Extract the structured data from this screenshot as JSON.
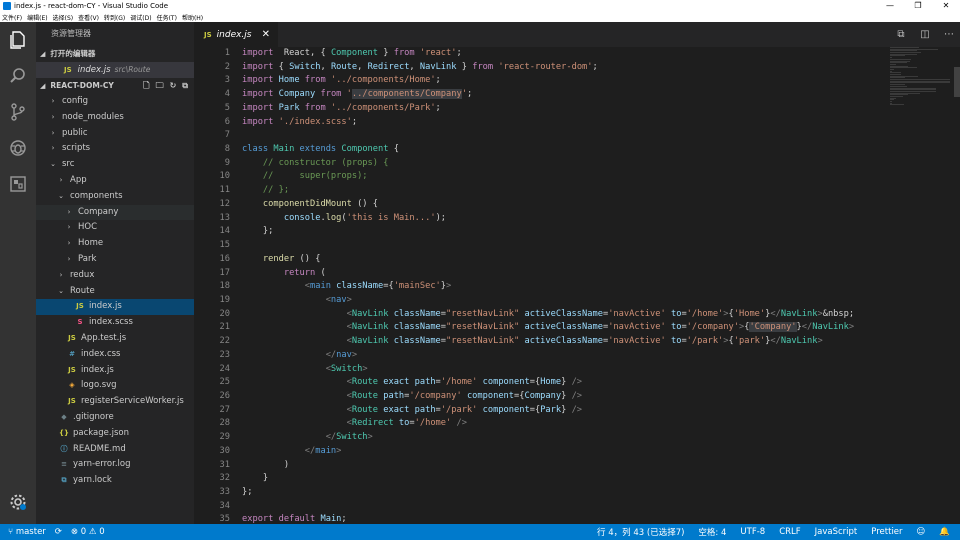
{
  "window": {
    "title": "index.js - react-dom-CY - Visual Studio Code",
    "minimize": "—",
    "maximize": "❐",
    "close": "✕"
  },
  "menu": [
    "文件(F)",
    "编辑(E)",
    "选择(S)",
    "查看(V)",
    "转到(G)",
    "调试(D)",
    "任务(T)",
    "帮助(H)"
  ],
  "sidebar": {
    "title": "资源管理器",
    "open_editors_label": "打开的编辑器",
    "open_editor": {
      "icon": "JS",
      "name": "index.js",
      "path": "src\\Route"
    },
    "project_label": "REACT-DOM-CY",
    "tree": [
      {
        "label": "config",
        "indent": 1,
        "twisty": "›",
        "icon": "",
        "icon_color": ""
      },
      {
        "label": "node_modules",
        "indent": 1,
        "twisty": "›",
        "icon": "",
        "icon_color": ""
      },
      {
        "label": "public",
        "indent": 1,
        "twisty": "›",
        "icon": "",
        "icon_color": ""
      },
      {
        "label": "scripts",
        "indent": 1,
        "twisty": "›",
        "icon": "",
        "icon_color": ""
      },
      {
        "label": "src",
        "indent": 1,
        "twisty": "⌄",
        "icon": "",
        "icon_color": ""
      },
      {
        "label": "App",
        "indent": 2,
        "twisty": "›",
        "icon": "",
        "icon_color": ""
      },
      {
        "label": "components",
        "indent": 2,
        "twisty": "⌄",
        "icon": "",
        "icon_color": ""
      },
      {
        "label": "Company",
        "indent": 3,
        "twisty": "›",
        "icon": "",
        "icon_color": "",
        "state": "hover"
      },
      {
        "label": "HOC",
        "indent": 3,
        "twisty": "›",
        "icon": "",
        "icon_color": ""
      },
      {
        "label": "Home",
        "indent": 3,
        "twisty": "›",
        "icon": "",
        "icon_color": ""
      },
      {
        "label": "Park",
        "indent": 3,
        "twisty": "›",
        "icon": "",
        "icon_color": ""
      },
      {
        "label": "redux",
        "indent": 2,
        "twisty": "›",
        "icon": "",
        "icon_color": ""
      },
      {
        "label": "Route",
        "indent": 2,
        "twisty": "⌄",
        "icon": "",
        "icon_color": ""
      },
      {
        "label": "index.js",
        "indent": 3,
        "twisty": "",
        "icon": "JS",
        "icon_color": "#cbcb41",
        "state": "selected"
      },
      {
        "label": "index.scss",
        "indent": 3,
        "twisty": "",
        "icon": "S",
        "icon_color": "#f55385"
      },
      {
        "label": "App.test.js",
        "indent": 2,
        "twisty": "",
        "icon": "JS",
        "icon_color": "#cbcb41"
      },
      {
        "label": "index.css",
        "indent": 2,
        "twisty": "",
        "icon": "#",
        "icon_color": "#519aba"
      },
      {
        "label": "index.js",
        "indent": 2,
        "twisty": "",
        "icon": "JS",
        "icon_color": "#cbcb41"
      },
      {
        "label": "logo.svg",
        "indent": 2,
        "twisty": "",
        "icon": "◈",
        "icon_color": "#ffb13b"
      },
      {
        "label": "registerServiceWorker.js",
        "indent": 2,
        "twisty": "",
        "icon": "JS",
        "icon_color": "#cbcb41"
      },
      {
        "label": ".gitignore",
        "indent": 1,
        "twisty": "",
        "icon": "◆",
        "icon_color": "#6d8086"
      },
      {
        "label": "package.json",
        "indent": 1,
        "twisty": "",
        "icon": "{}",
        "icon_color": "#cbcb41"
      },
      {
        "label": "README.md",
        "indent": 1,
        "twisty": "",
        "icon": "ⓘ",
        "icon_color": "#519aba"
      },
      {
        "label": "yarn-error.log",
        "indent": 1,
        "twisty": "",
        "icon": "≡",
        "icon_color": "#6d8086"
      },
      {
        "label": "yarn.lock",
        "indent": 1,
        "twisty": "",
        "icon": "⧉",
        "icon_color": "#519aba"
      }
    ]
  },
  "editor": {
    "tab": {
      "icon": "JS",
      "name": "index.js",
      "close": "✕"
    },
    "lines": [
      [
        [
          "kw2",
          "import"
        ],
        [
          "",
          "  React, { "
        ],
        [
          "cls",
          "Component"
        ],
        [
          "",
          " } "
        ],
        [
          "kw2",
          "from"
        ],
        [
          "",
          " "
        ],
        [
          "str",
          "'react'"
        ],
        [
          "",
          ";"
        ]
      ],
      [
        [
          "kw2",
          "import"
        ],
        [
          "",
          " { "
        ],
        [
          "var",
          "Switch"
        ],
        [
          "",
          ", "
        ],
        [
          "var",
          "Route"
        ],
        [
          "",
          ", "
        ],
        [
          "var",
          "Redirect"
        ],
        [
          "",
          ", "
        ],
        [
          "var",
          "NavLink"
        ],
        [
          "",
          " } "
        ],
        [
          "kw2",
          "from"
        ],
        [
          "",
          " "
        ],
        [
          "str",
          "'react-router-dom'"
        ],
        [
          "",
          ";"
        ]
      ],
      [
        [
          "kw2",
          "import"
        ],
        [
          "",
          " "
        ],
        [
          "var",
          "Home"
        ],
        [
          "",
          " "
        ],
        [
          "kw2",
          "from"
        ],
        [
          "",
          " "
        ],
        [
          "str",
          "'../components/Home'"
        ],
        [
          "",
          ";"
        ]
      ],
      [
        [
          "kw2",
          "import"
        ],
        [
          "",
          " "
        ],
        [
          "var",
          "Company"
        ],
        [
          "",
          " "
        ],
        [
          "kw2",
          "from"
        ],
        [
          "",
          " "
        ],
        [
          "str",
          "'"
        ],
        [
          "strhl",
          "../components/Company"
        ],
        [
          "str",
          "'"
        ],
        [
          "",
          ";"
        ]
      ],
      [
        [
          "kw2",
          "import"
        ],
        [
          "",
          " "
        ],
        [
          "var",
          "Park"
        ],
        [
          "",
          " "
        ],
        [
          "kw2",
          "from"
        ],
        [
          "",
          " "
        ],
        [
          "str",
          "'../components/Park'"
        ],
        [
          "",
          ";"
        ]
      ],
      [
        [
          "kw2",
          "import"
        ],
        [
          "",
          " "
        ],
        [
          "str",
          "'./index.scss'"
        ],
        [
          "",
          ";"
        ]
      ],
      [
        [
          "",
          ""
        ]
      ],
      [
        [
          "kw",
          "class"
        ],
        [
          "",
          " "
        ],
        [
          "cls",
          "Main"
        ],
        [
          "",
          " "
        ],
        [
          "kw",
          "extends"
        ],
        [
          "",
          " "
        ],
        [
          "cls",
          "Component"
        ],
        [
          "",
          " {"
        ]
      ],
      [
        [
          "",
          "    "
        ],
        [
          "cm",
          "// constructor (props) {"
        ]
      ],
      [
        [
          "",
          "    "
        ],
        [
          "cm",
          "//     super(props);"
        ]
      ],
      [
        [
          "",
          "    "
        ],
        [
          "cm",
          "// };"
        ]
      ],
      [
        [
          "",
          "    "
        ],
        [
          "fn",
          "componentDidMount"
        ],
        [
          "",
          " () {"
        ]
      ],
      [
        [
          "",
          "        "
        ],
        [
          "var",
          "console"
        ],
        [
          "",
          "."
        ],
        [
          "fn",
          "log"
        ],
        [
          "",
          "("
        ],
        [
          "str",
          "'this is Main...'"
        ],
        [
          "",
          ");"
        ]
      ],
      [
        [
          "",
          "    };"
        ]
      ],
      [
        [
          "",
          ""
        ]
      ],
      [
        [
          "",
          "    "
        ],
        [
          "fn",
          "render"
        ],
        [
          "",
          " () {"
        ]
      ],
      [
        [
          "",
          "        "
        ],
        [
          "kw2",
          "return"
        ],
        [
          "",
          " ("
        ]
      ],
      [
        [
          "",
          "            "
        ],
        [
          "brk",
          "<"
        ],
        [
          "tag",
          "main"
        ],
        [
          "",
          " "
        ],
        [
          "attr",
          "className"
        ],
        [
          "",
          "={"
        ],
        [
          "str",
          "'mainSec'"
        ],
        [
          "",
          "}"
        ],
        [
          "brk",
          ">"
        ]
      ],
      [
        [
          "",
          "                "
        ],
        [
          "brk",
          "<"
        ],
        [
          "tag",
          "nav"
        ],
        [
          "brk",
          ">"
        ]
      ],
      [
        [
          "",
          "                    "
        ],
        [
          "brk",
          "<"
        ],
        [
          "cls",
          "NavLink"
        ],
        [
          "",
          " "
        ],
        [
          "attr",
          "className"
        ],
        [
          "",
          "="
        ],
        [
          "str",
          "\"resetNavLink\""
        ],
        [
          "",
          " "
        ],
        [
          "attr",
          "activeClassName"
        ],
        [
          "",
          "="
        ],
        [
          "str",
          "'navActive'"
        ],
        [
          "",
          " "
        ],
        [
          "attr",
          "to"
        ],
        [
          "",
          "="
        ],
        [
          "str",
          "'/home'"
        ],
        [
          "brk",
          ">"
        ],
        [
          "",
          "{"
        ],
        [
          "str",
          "'Home'"
        ],
        [
          "",
          "}"
        ],
        [
          "brk",
          "</"
        ],
        [
          "cls",
          "NavLink"
        ],
        [
          "brk",
          ">"
        ],
        [
          "",
          "&nbsp;"
        ]
      ],
      [
        [
          "",
          "                    "
        ],
        [
          "brk",
          "<"
        ],
        [
          "cls",
          "NavLink"
        ],
        [
          "",
          " "
        ],
        [
          "attr",
          "className"
        ],
        [
          "",
          "="
        ],
        [
          "str",
          "\"resetNavLink\""
        ],
        [
          "",
          " "
        ],
        [
          "attr",
          "activeClassName"
        ],
        [
          "",
          "="
        ],
        [
          "str",
          "'navActive'"
        ],
        [
          "",
          " "
        ],
        [
          "attr",
          "to"
        ],
        [
          "",
          "="
        ],
        [
          "str",
          "'/company'"
        ],
        [
          "brk",
          ">"
        ],
        [
          "",
          "{"
        ],
        [
          "strhl",
          "'Company'"
        ],
        [
          "",
          "}"
        ],
        [
          "brk",
          "</"
        ],
        [
          "cls",
          "NavLink"
        ],
        [
          "brk",
          ">"
        ]
      ],
      [
        [
          "",
          "                    "
        ],
        [
          "brk",
          "<"
        ],
        [
          "cls",
          "NavLink"
        ],
        [
          "",
          " "
        ],
        [
          "attr",
          "className"
        ],
        [
          "",
          "="
        ],
        [
          "str",
          "\"resetNavLink\""
        ],
        [
          "",
          " "
        ],
        [
          "attr",
          "activeClassName"
        ],
        [
          "",
          "="
        ],
        [
          "str",
          "'navActive'"
        ],
        [
          "",
          " "
        ],
        [
          "attr",
          "to"
        ],
        [
          "",
          "="
        ],
        [
          "str",
          "'/park'"
        ],
        [
          "brk",
          ">"
        ],
        [
          "",
          "{"
        ],
        [
          "str",
          "'park'"
        ],
        [
          "",
          "}"
        ],
        [
          "brk",
          "</"
        ],
        [
          "cls",
          "NavLink"
        ],
        [
          "brk",
          ">"
        ]
      ],
      [
        [
          "",
          "                "
        ],
        [
          "brk",
          "</"
        ],
        [
          "tag",
          "nav"
        ],
        [
          "brk",
          ">"
        ]
      ],
      [
        [
          "",
          "                "
        ],
        [
          "brk",
          "<"
        ],
        [
          "cls",
          "Switch"
        ],
        [
          "brk",
          ">"
        ]
      ],
      [
        [
          "",
          "                    "
        ],
        [
          "brk",
          "<"
        ],
        [
          "cls",
          "Route"
        ],
        [
          "",
          " "
        ],
        [
          "attr",
          "exact"
        ],
        [
          "",
          " "
        ],
        [
          "attr",
          "path"
        ],
        [
          "",
          "="
        ],
        [
          "str",
          "'/home'"
        ],
        [
          "",
          " "
        ],
        [
          "attr",
          "component"
        ],
        [
          "",
          "={"
        ],
        [
          "var",
          "Home"
        ],
        [
          "",
          "} "
        ],
        [
          "brk",
          "/>"
        ]
      ],
      [
        [
          "",
          "                    "
        ],
        [
          "brk",
          "<"
        ],
        [
          "cls",
          "Route"
        ],
        [
          "",
          " "
        ],
        [
          "attr",
          "path"
        ],
        [
          "",
          "="
        ],
        [
          "str",
          "'/company'"
        ],
        [
          "",
          " "
        ],
        [
          "attr",
          "component"
        ],
        [
          "",
          "={"
        ],
        [
          "var",
          "Company"
        ],
        [
          "",
          "} "
        ],
        [
          "brk",
          "/>"
        ]
      ],
      [
        [
          "",
          "                    "
        ],
        [
          "brk",
          "<"
        ],
        [
          "cls",
          "Route"
        ],
        [
          "",
          " "
        ],
        [
          "attr",
          "exact"
        ],
        [
          "",
          " "
        ],
        [
          "attr",
          "path"
        ],
        [
          "",
          "="
        ],
        [
          "str",
          "'/park'"
        ],
        [
          "",
          " "
        ],
        [
          "attr",
          "component"
        ],
        [
          "",
          "={"
        ],
        [
          "var",
          "Park"
        ],
        [
          "",
          "} "
        ],
        [
          "brk",
          "/>"
        ]
      ],
      [
        [
          "",
          "                    "
        ],
        [
          "brk",
          "<"
        ],
        [
          "cls",
          "Redirect"
        ],
        [
          "",
          " "
        ],
        [
          "attr",
          "to"
        ],
        [
          "",
          "="
        ],
        [
          "str",
          "'/home'"
        ],
        [
          "",
          " "
        ],
        [
          "brk",
          "/>"
        ]
      ],
      [
        [
          "",
          "                "
        ],
        [
          "brk",
          "</"
        ],
        [
          "cls",
          "Switch"
        ],
        [
          "brk",
          ">"
        ]
      ],
      [
        [
          "",
          "            "
        ],
        [
          "brk",
          "</"
        ],
        [
          "tag",
          "main"
        ],
        [
          "brk",
          ">"
        ]
      ],
      [
        [
          "",
          "        )"
        ]
      ],
      [
        [
          "",
          "    }"
        ]
      ],
      [
        [
          "",
          "};"
        ]
      ],
      [
        [
          "",
          ""
        ]
      ],
      [
        [
          "kw2",
          "export"
        ],
        [
          "",
          " "
        ],
        [
          "kw2",
          "default"
        ],
        [
          "",
          " "
        ],
        [
          "var",
          "Main"
        ],
        [
          "",
          ";"
        ]
      ]
    ]
  },
  "status": {
    "branch": "master",
    "errors": "0",
    "warnings": "0",
    "position": "行 4，列 43 (已选择7)",
    "spaces": "空格: 4",
    "encoding": "UTF-8",
    "eol": "CRLF",
    "language": "JavaScript",
    "formatter": "Prettier",
    "smiley": "☺",
    "bell": "🔔"
  },
  "colors": {
    "statusbar": "#007acc",
    "activitybar": "#333333",
    "sidebar": "#252526",
    "editor": "#1e1e1e",
    "selected": "#094771"
  }
}
